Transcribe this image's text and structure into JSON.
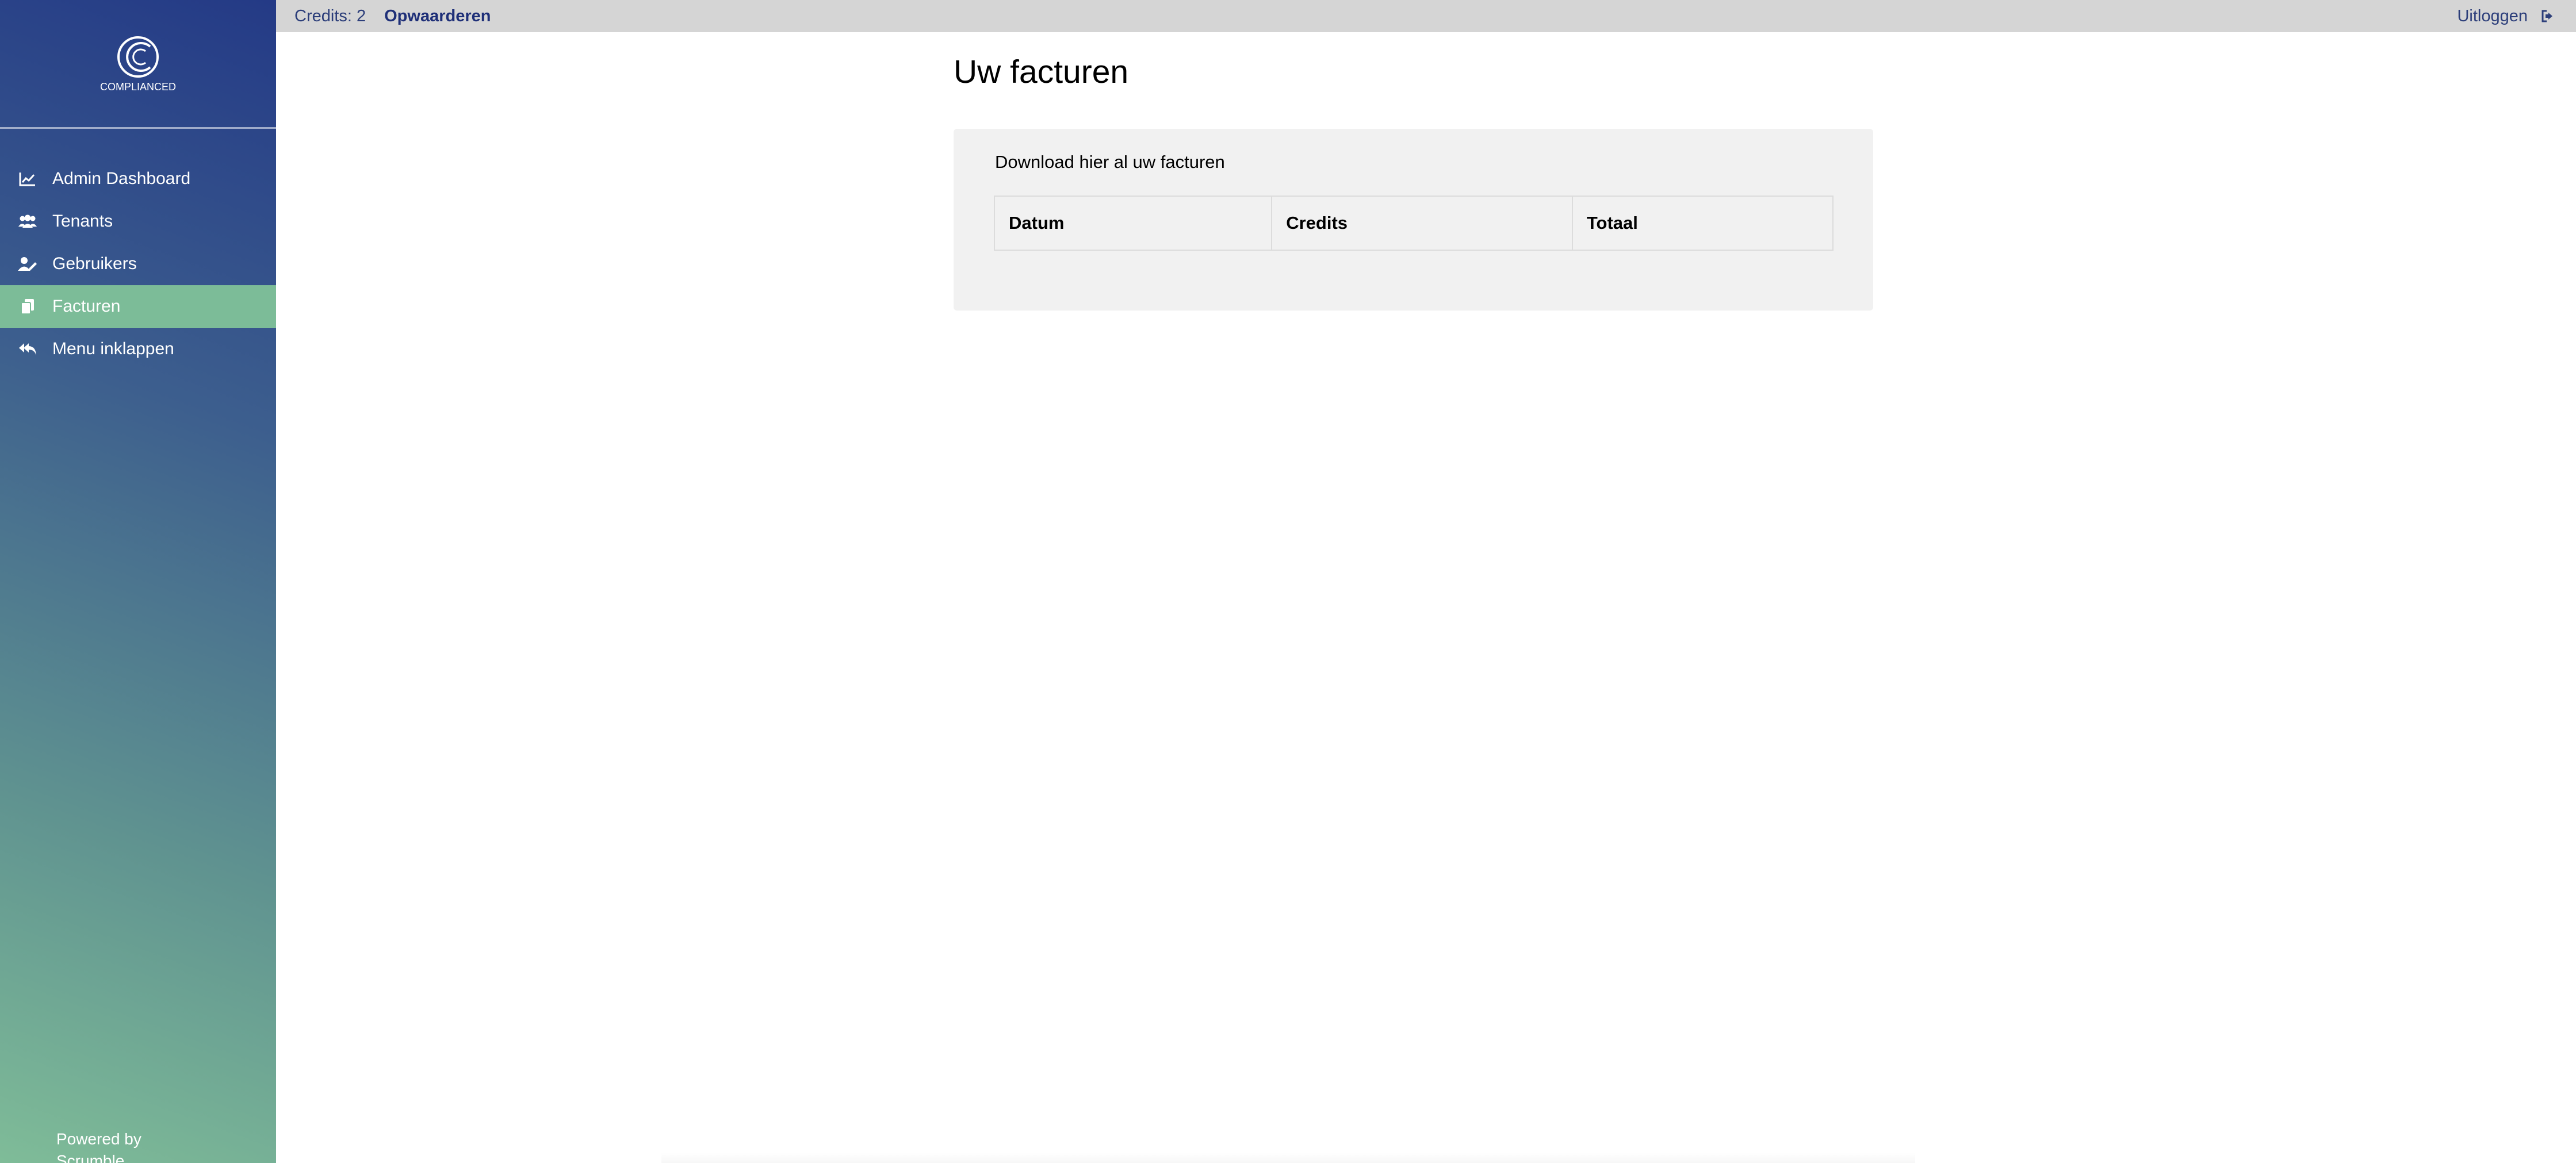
{
  "sidebar": {
    "logo_text": "COMPLIANCED",
    "items": [
      {
        "label": "Admin Dashboard",
        "icon": "chart-line-icon"
      },
      {
        "label": "Tenants",
        "icon": "users-icon"
      },
      {
        "label": "Gebruikers",
        "icon": "user-edit-icon"
      },
      {
        "label": "Facturen",
        "icon": "copy-icon",
        "active": true
      },
      {
        "label": "Menu inklappen",
        "icon": "reply-all-icon"
      }
    ],
    "powered_line1": "Powered by",
    "powered_line2": "Scrumble"
  },
  "topbar": {
    "credits": "Credits: 2",
    "upgrade": "Opwaarderen",
    "logout": "Uitloggen",
    "logout_icon": "sign-out-icon"
  },
  "main": {
    "title": "Uw facturen",
    "card_text": "Download hier al uw facturen",
    "columns": [
      "Datum",
      "Credits",
      "Totaal"
    ]
  },
  "colors": {
    "sidebar_top": "#243a86",
    "sidebar_bottom": "#7fbc98",
    "active_item": "#7cbc98",
    "topbar": "#d5d5d5",
    "link": "#1e2f78",
    "card": "#f1f1f1"
  }
}
